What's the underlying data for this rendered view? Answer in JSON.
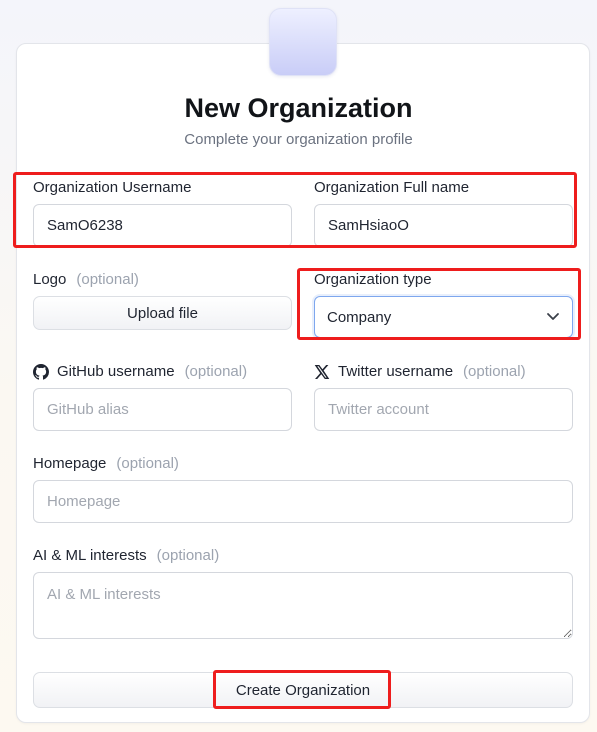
{
  "header": {
    "title": "New Organization",
    "subtitle": "Complete your organization profile"
  },
  "form": {
    "optional_text": "(optional)",
    "username": {
      "label": "Organization Username",
      "value": "SamO6238"
    },
    "fullname": {
      "label": "Organization Full name",
      "value": "SamHsiaoO"
    },
    "logo": {
      "label": "Logo",
      "button": "Upload file"
    },
    "org_type": {
      "label": "Organization type",
      "selected": "Company"
    },
    "github": {
      "label": "GitHub username",
      "placeholder": "GitHub alias",
      "icon": "github-icon"
    },
    "twitter": {
      "label": "Twitter username",
      "placeholder": "Twitter account",
      "icon": "x-icon"
    },
    "homepage": {
      "label": "Homepage",
      "placeholder": "Homepage"
    },
    "interests": {
      "label": "AI & ML interests",
      "placeholder": "AI & ML interests"
    },
    "submit": "Create Organization"
  },
  "colors": {
    "highlight": "#ee1d1d",
    "focus_border": "#7ea7ee"
  }
}
